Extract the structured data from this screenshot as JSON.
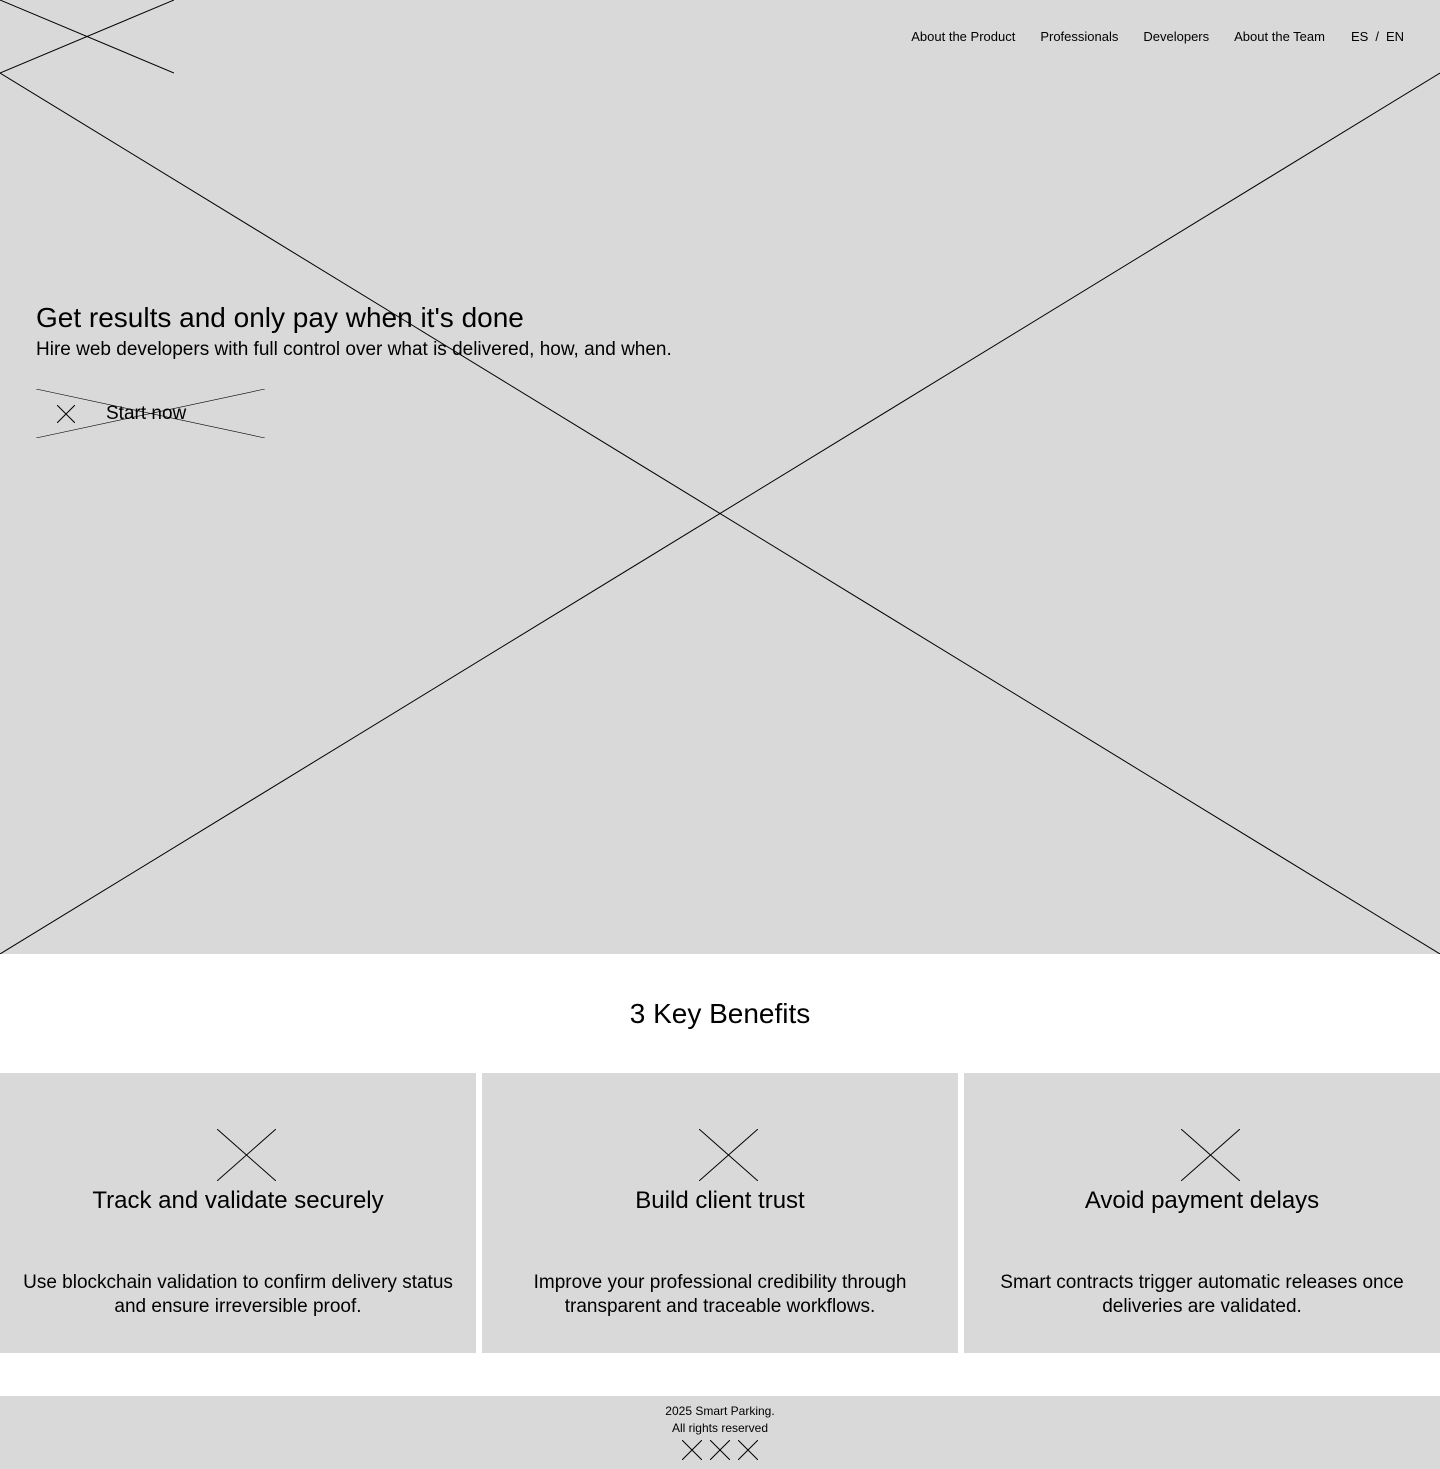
{
  "nav": {
    "items": [
      "About the Product",
      "Professionals",
      "Developers",
      "About the Team"
    ],
    "lang_es": "ES",
    "lang_sep": "/",
    "lang_en": "EN"
  },
  "hero": {
    "title": "Get results and only pay when it's done",
    "subtitle": "Hire web developers with full control over what is delivered, how, and when.",
    "cta_label": "Start now"
  },
  "benefits": {
    "heading": "3 Key Benefits",
    "cards": [
      {
        "title": "Track and validate securely",
        "text": "Use blockchain validation to confirm delivery status and ensure irreversible proof."
      },
      {
        "title": "Build client trust",
        "text": "Improve your professional credibility through transparent and traceable workflows."
      },
      {
        "title": "Avoid payment delays",
        "text": "Smart contracts trigger automatic releases once deliveries are validated."
      }
    ]
  },
  "footer": {
    "line1": "2025 Smart Parking.",
    "line2": "All rights reserved"
  },
  "colors": {
    "placeholder_gray": "#d9d9d9",
    "background": "#ffffff",
    "text": "#000000"
  },
  "icons": {
    "logo": "logo-placeholder-icon",
    "cta": "close-x-icon",
    "cards": [
      "benefit-image-placeholder-icon",
      "benefit-image-placeholder-icon",
      "benefit-image-placeholder-icon"
    ],
    "footer_social": [
      "social-icon",
      "social-icon",
      "social-icon"
    ]
  }
}
